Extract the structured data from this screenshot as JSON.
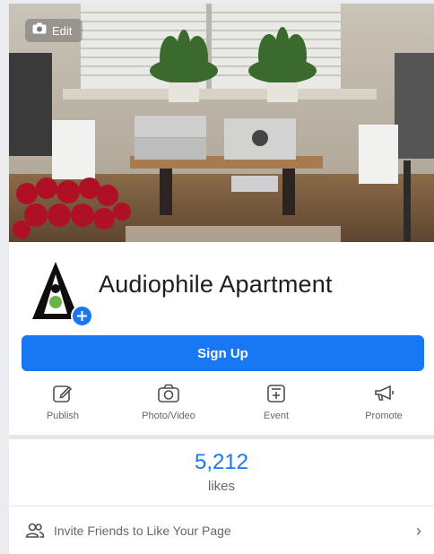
{
  "cover": {
    "edit_label": "Edit"
  },
  "page": {
    "title": "Audiophile Apartment"
  },
  "cta": {
    "label": "Sign Up"
  },
  "actions": [
    {
      "label": "Publish",
      "icon": "edit-icon"
    },
    {
      "label": "Photo/Video",
      "icon": "camera-icon"
    },
    {
      "label": "Event",
      "icon": "calendar-plus-icon"
    },
    {
      "label": "Promote",
      "icon": "megaphone-icon"
    }
  ],
  "stats": {
    "likes_count": "5,212",
    "likes_label": "likes"
  },
  "invite": {
    "label": "Invite Friends to Like Your Page",
    "chevron": "›"
  },
  "colors": {
    "accent": "#1877f2",
    "muted": "#65676b",
    "text": "#1c1e21"
  }
}
